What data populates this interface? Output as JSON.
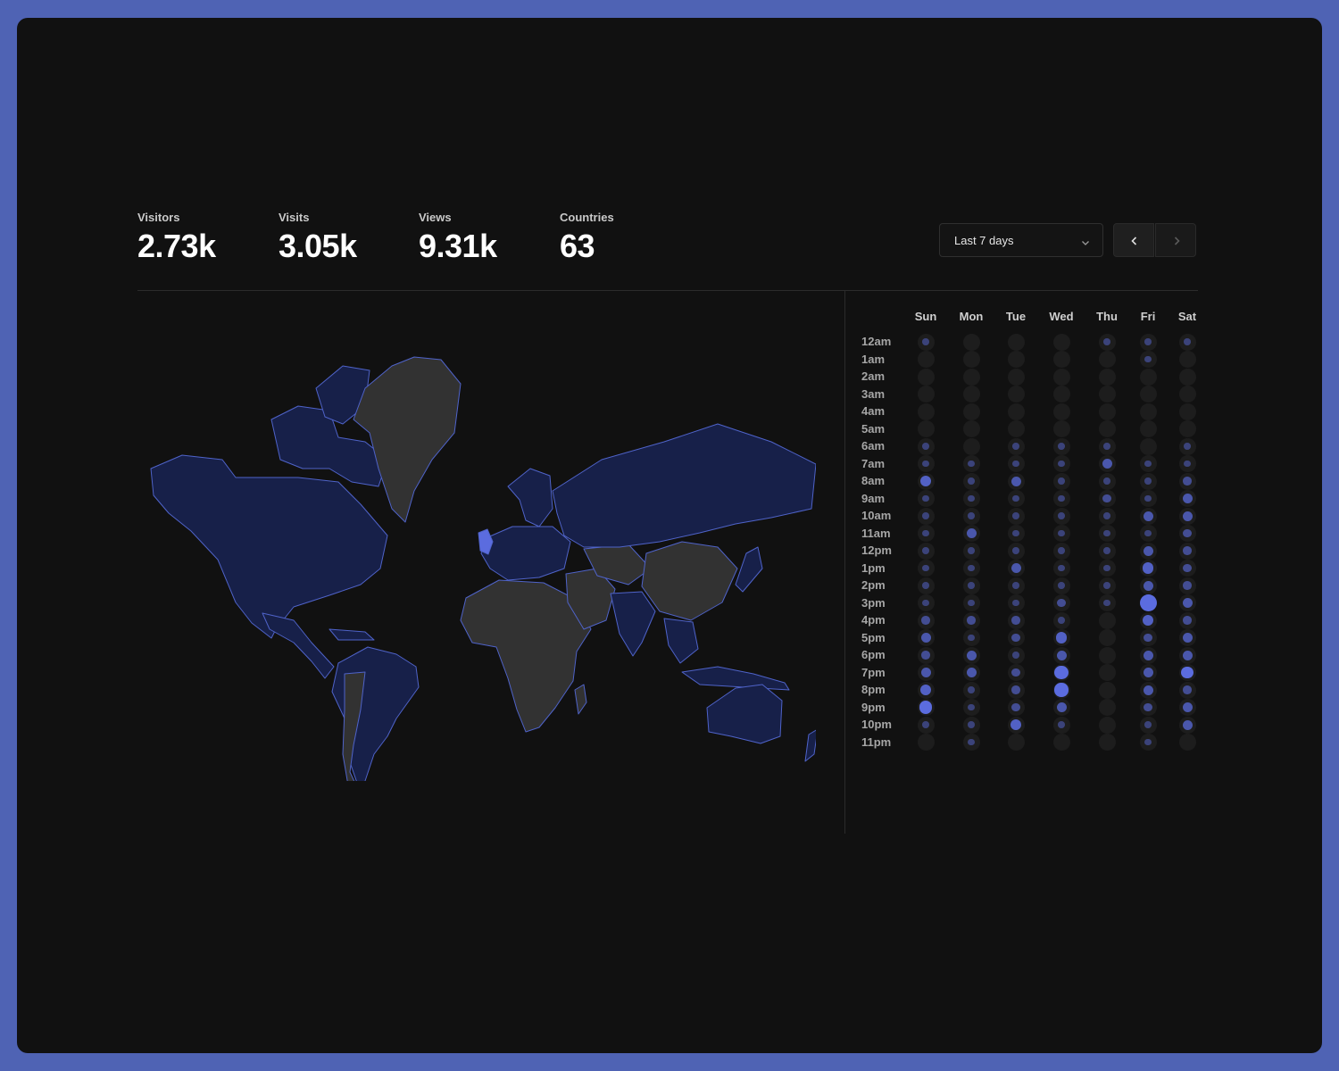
{
  "stats": [
    {
      "label": "Visitors",
      "value": "2.73k"
    },
    {
      "label": "Visits",
      "value": "3.05k"
    },
    {
      "label": "Views",
      "value": "9.31k"
    },
    {
      "label": "Countries",
      "value": "63"
    }
  ],
  "range": {
    "selected": "Last 7 days"
  },
  "icons": {
    "dropdown": "chevron-down-icon",
    "prev": "chevron-left-icon",
    "next": "chevron-right-icon"
  },
  "colors": {
    "accent": "#5b6cdf",
    "map_land": "#323232",
    "map_visited": "#172049",
    "map_highlight": "#5b6cdf",
    "map_border": "#4f63c9"
  },
  "chart_data": {
    "type": "heatmap",
    "days": [
      "Sun",
      "Mon",
      "Tue",
      "Wed",
      "Thu",
      "Fri",
      "Sat"
    ],
    "hours": [
      "12am",
      "1am",
      "2am",
      "3am",
      "4am",
      "5am",
      "6am",
      "7am",
      "8am",
      "9am",
      "10am",
      "11am",
      "12pm",
      "1pm",
      "2pm",
      "3pm",
      "4pm",
      "5pm",
      "6pm",
      "7pm",
      "8pm",
      "9pm",
      "10pm",
      "11pm"
    ],
    "values": [
      [
        1,
        0,
        0,
        0,
        0,
        0,
        1,
        1,
        4,
        1,
        1,
        1,
        1,
        1,
        1,
        1,
        2,
        3,
        2,
        3,
        4,
        6,
        1,
        0
      ],
      [
        0,
        0,
        0,
        0,
        0,
        0,
        0,
        1,
        1,
        1,
        1,
        3,
        1,
        1,
        1,
        1,
        2,
        1,
        3,
        3,
        1,
        1,
        1,
        1
      ],
      [
        0,
        0,
        0,
        0,
        0,
        0,
        1,
        1,
        3,
        1,
        1,
        1,
        1,
        3,
        1,
        1,
        2,
        2,
        1,
        2,
        2,
        2,
        4,
        0
      ],
      [
        0,
        0,
        0,
        0,
        0,
        0,
        1,
        1,
        1,
        1,
        1,
        1,
        1,
        1,
        1,
        2,
        1,
        4,
        3,
        7,
        7,
        3,
        1,
        0
      ],
      [
        1,
        0,
        0,
        0,
        0,
        0,
        1,
        3,
        1,
        2,
        1,
        1,
        1,
        1,
        1,
        1,
        0,
        0,
        0,
        0,
        0,
        0,
        0,
        0
      ],
      [
        1,
        1,
        0,
        0,
        0,
        0,
        0,
        1,
        1,
        1,
        3,
        1,
        3,
        4,
        3,
        12,
        4,
        2,
        3,
        3,
        3,
        2,
        1,
        1
      ],
      [
        1,
        0,
        0,
        0,
        0,
        0,
        1,
        1,
        2,
        3,
        3,
        2,
        2,
        2,
        2,
        3,
        2,
        3,
        3,
        5,
        2,
        3,
        3,
        0
      ]
    ]
  }
}
